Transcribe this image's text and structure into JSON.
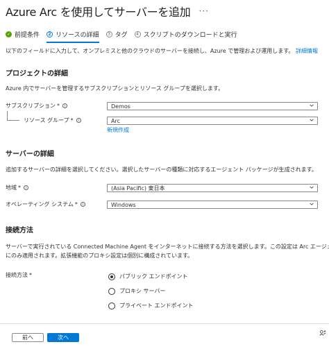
{
  "page": {
    "title": "Azure Arc を使用してサーバーを追加",
    "more": "···"
  },
  "steps": [
    {
      "label": "前提条件",
      "num": "✓"
    },
    {
      "label": "リソースの詳細",
      "num": "2"
    },
    {
      "label": "タグ",
      "num": "3"
    },
    {
      "label": "スクリプトのダウンロードと実行",
      "num": "4"
    }
  ],
  "intro": {
    "text": "以下のフィールドに入力して、オンプレミスと他のクラウドのサーバーを接続し、Azure で管理および運用します。",
    "link": "詳細情報"
  },
  "project": {
    "heading": "プロジェクトの詳細",
    "description": "Azure 内でサーバーを管理するサブスクリプションとリソース グループを選択します。",
    "subscription_label": "サブスクリプション",
    "subscription_value": "Demos",
    "resource_group_label": "リソース グループ",
    "resource_group_value": "Arc",
    "create_new": "新規作成",
    "required": "*"
  },
  "server": {
    "heading": "サーバーの詳細",
    "description": "追加するサーバーの詳細を選択してください。選択したサーバーの種類に対応するエージェント パッケージが生成されます。",
    "region_label": "地域",
    "region_value": "(Asia Pacific) 東日本",
    "os_label": "オペレーティング システム",
    "os_value": "Windows",
    "required": "*"
  },
  "connect": {
    "heading": "接続方法",
    "description_1": "サーバーで実行されている Connected Machine Agent をインターネットに接続する方法を選択します。この設定は Arc エージェント",
    "description_2": "にのみ適用されます。拡張機能のプロキシ設定は個別に構成されています。",
    "label": "接続方法",
    "required": "*",
    "options": [
      "パブリック エンドポイント",
      "プロキシ サーバー",
      "プライベート エンドポイント"
    ],
    "selected_index": 0
  },
  "footer": {
    "prev": "前へ",
    "next": "次へ"
  },
  "colors": {
    "accent": "#0078d4",
    "done": "#57a300"
  }
}
